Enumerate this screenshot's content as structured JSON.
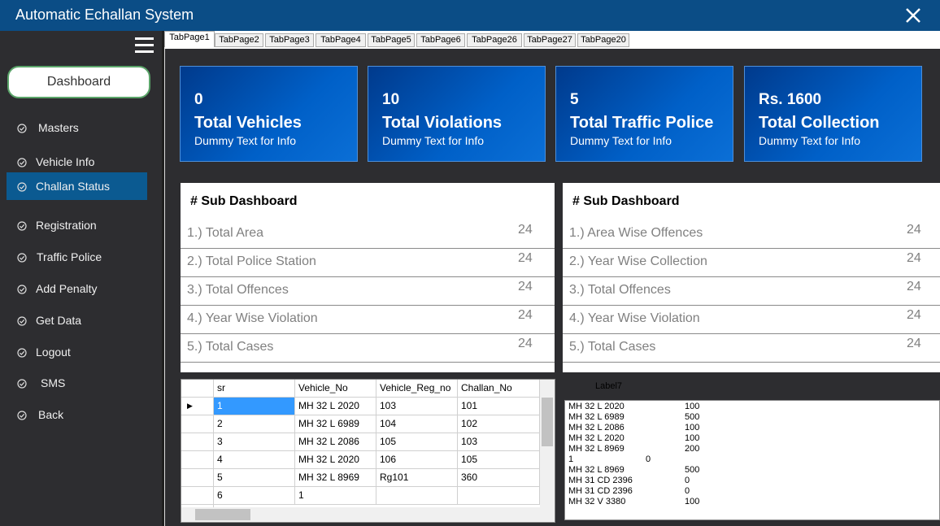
{
  "window": {
    "title": "Automatic Echallan System",
    "close_icon": "close-icon"
  },
  "sidebar": {
    "dashboard_label": "Dashboard",
    "items": [
      {
        "label": "Masters"
      },
      {
        "label": "Vehicle Info"
      },
      {
        "label": "Challan Status"
      },
      {
        "label": "Registration"
      },
      {
        "label": "Traffic Police"
      },
      {
        "label": "Add Penalty"
      },
      {
        "label": "Get Data"
      },
      {
        "label": "Logout"
      },
      {
        "label": "SMS"
      },
      {
        "label": "Back"
      }
    ],
    "active_item": "Challan Status",
    "active_color": "#0b5a91"
  },
  "tabs": [
    "TabPage1",
    "TabPage2",
    "TabPage3",
    "TabPage4",
    "TabPage5",
    "TabPage6",
    "TabPage26",
    "TabPage27",
    "TabPage20"
  ],
  "cards": [
    {
      "value": "0",
      "name": "Total Vehicles",
      "sub": "Dummy Text for Info"
    },
    {
      "value": "10",
      "name": "Total Violations",
      "sub": "Dummy Text for Info"
    },
    {
      "value": "5",
      "name": "Total Traffic Police",
      "sub": "Dummy Text for Info"
    },
    {
      "value": "Rs. 1600",
      "name": "Total Collection",
      "sub": "Dummy Text for Info"
    }
  ],
  "panels": [
    {
      "title": "# Sub Dashboard",
      "rows": [
        {
          "label": "1.) Total Area",
          "value": "24"
        },
        {
          "label": "2.) Total Police Station",
          "value": "24"
        },
        {
          "label": "3.) Total Offences",
          "value": "24"
        },
        {
          "label": "4.) Year Wise Violation",
          "value": "24"
        },
        {
          "label": "5.) Total Cases",
          "value": "24"
        }
      ]
    },
    {
      "title": "# Sub Dashboard",
      "rows": [
        {
          "label": "1.) Area Wise Offences",
          "value": "24"
        },
        {
          "label": "2.) Year Wise Collection",
          "value": "24"
        },
        {
          "label": "3.) Total Offences",
          "value": "24"
        },
        {
          "label": "4.) Year Wise Violation",
          "value": "24"
        },
        {
          "label": "5.) Total Cases",
          "value": "24"
        }
      ]
    }
  ],
  "grid": {
    "columns": [
      "sr",
      "Vehicle_No",
      "Vehicle_Reg_no",
      "Challan_No"
    ],
    "rows": [
      [
        "1",
        "MH 32 L 2020",
        "103",
        "101"
      ],
      [
        "2",
        "MH 32 L 6989",
        "104",
        "102"
      ],
      [
        "3",
        "MH 32 L 2086",
        "105",
        "103"
      ],
      [
        "4",
        "MH 32 L 2020",
        "106",
        "105"
      ],
      [
        "5",
        "MH 32 L 8969",
        "Rg101",
        "360"
      ],
      [
        "6",
        "1",
        "",
        ""
      ]
    ],
    "current_row_marker": "▶"
  },
  "label7": "Label7",
  "textbox_lines": [
    [
      "MH 32 L 2020",
      "100"
    ],
    [
      "MH 32 L 6989",
      "500"
    ],
    [
      "MH 32 L 2086",
      "100"
    ],
    [
      "MH 32 L 2020",
      "100"
    ],
    [
      "MH 32 L 8969",
      "200"
    ],
    [
      "1",
      "0"
    ],
    [
      "MH 32 L 8969",
      "500"
    ],
    [
      "MH 31 CD 2396",
      "0"
    ],
    [
      "MH 31 CD 2396",
      "0"
    ],
    [
      "MH 32 V 3380",
      "100"
    ]
  ]
}
